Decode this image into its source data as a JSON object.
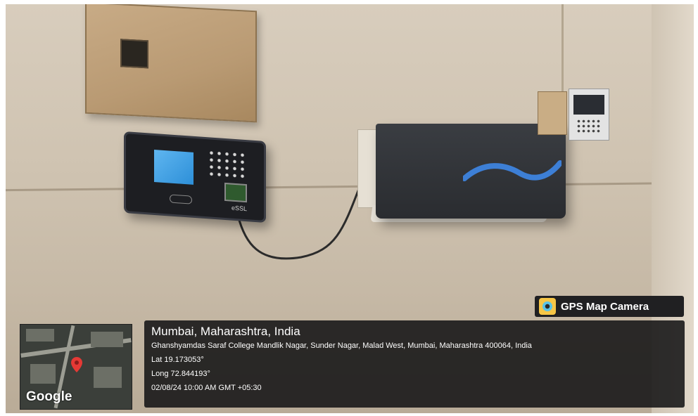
{
  "overlay": {
    "app_badge": "GPS Map Camera",
    "map_label": "Google",
    "location_title": "Mumbai, Maharashtra, India",
    "address": "Ghanshyamdas Saraf College Mandlik Nagar, Sunder Nagar, Malad West, Mumbai, Maharashtra 400064, India",
    "latitude": "Lat 19.173053°",
    "longitude": "Long 72.844193°",
    "timestamp": "02/08/24 10:00 AM GMT +05:30"
  },
  "devices": {
    "biometric_brand": "eSSL"
  },
  "colors": {
    "wall": "#d8cdbd",
    "overlay_bg": "#141416",
    "biometric_screen": "#2d8fd8",
    "map_pin": "#e53935"
  },
  "icons": {
    "badge_icon": "camera-lens-icon",
    "map_pin": "map-pin-icon"
  }
}
